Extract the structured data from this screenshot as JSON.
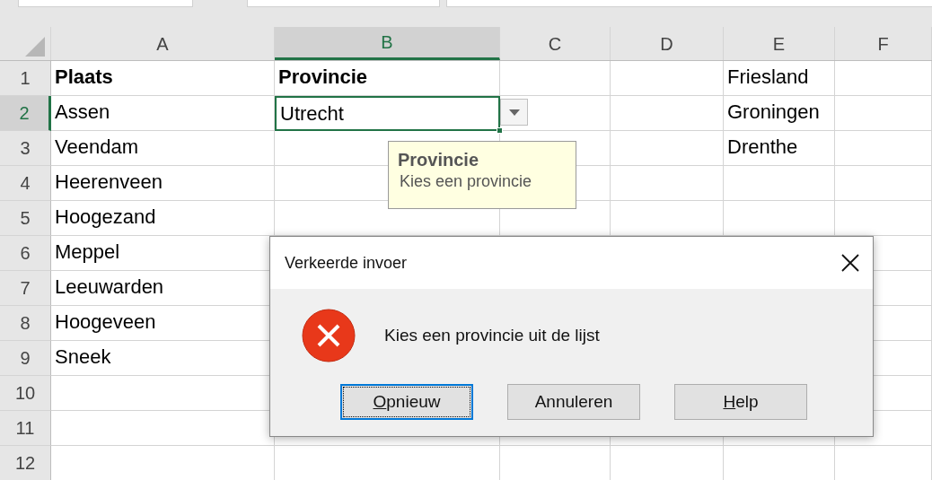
{
  "columns": [
    {
      "label": "A",
      "selected": false,
      "cells": [
        {
          "text": "Plaats",
          "bold": true,
          "selected": false
        },
        {
          "text": "Assen",
          "bold": false,
          "selected": false
        },
        {
          "text": "Veendam",
          "bold": false,
          "selected": false
        },
        {
          "text": "Heerenveen",
          "bold": false,
          "selected": false
        },
        {
          "text": "Hoogezand",
          "bold": false,
          "selected": false
        },
        {
          "text": "Meppel",
          "bold": false,
          "selected": false
        },
        {
          "text": "Leeuwarden",
          "bold": false,
          "selected": false
        },
        {
          "text": "Hoogeveen",
          "bold": false,
          "selected": false
        },
        {
          "text": "Sneek",
          "bold": false,
          "selected": false
        }
      ]
    },
    {
      "label": "B",
      "selected": true,
      "cells": [
        {
          "text": "Provincie",
          "bold": true,
          "selected": false
        },
        {
          "text": "Utrecht",
          "bold": false,
          "selected": true
        }
      ]
    },
    {
      "label": "C",
      "selected": false
    },
    {
      "label": "D",
      "selected": false
    },
    {
      "label": "E",
      "selected": false,
      "cells": [
        {
          "text": "Friesland",
          "bold": false,
          "selected": false
        },
        {
          "text": "Groningen",
          "bold": false,
          "selected": false
        },
        {
          "text": "Drenthe",
          "bold": false,
          "selected": false
        }
      ]
    },
    {
      "label": "F",
      "selected": false
    }
  ],
  "rows": [
    {
      "number": "1",
      "selected": false
    },
    {
      "number": "2",
      "selected": true
    },
    {
      "number": "3",
      "selected": false
    },
    {
      "number": "4",
      "selected": false
    },
    {
      "number": "5",
      "selected": false
    },
    {
      "number": "6",
      "selected": false
    },
    {
      "number": "7",
      "selected": false
    },
    {
      "number": "8",
      "selected": false
    },
    {
      "number": "9",
      "selected": false
    },
    {
      "number": "10",
      "selected": false
    },
    {
      "number": "11",
      "selected": false
    },
    {
      "number": "12",
      "selected": false
    }
  ],
  "tooltip": {
    "title": "Provincie",
    "message": "Kies een provincie"
  },
  "dialog": {
    "title": "Verkeerde invoer",
    "message": "Kies een provincie uit de lijst",
    "buttons": [
      {
        "label": "Opnieuw",
        "underline_first": true,
        "default": true
      },
      {
        "label": "Annuleren",
        "underline_first": false,
        "default": false
      },
      {
        "label": "Help",
        "underline_first": true,
        "default": false
      }
    ]
  }
}
